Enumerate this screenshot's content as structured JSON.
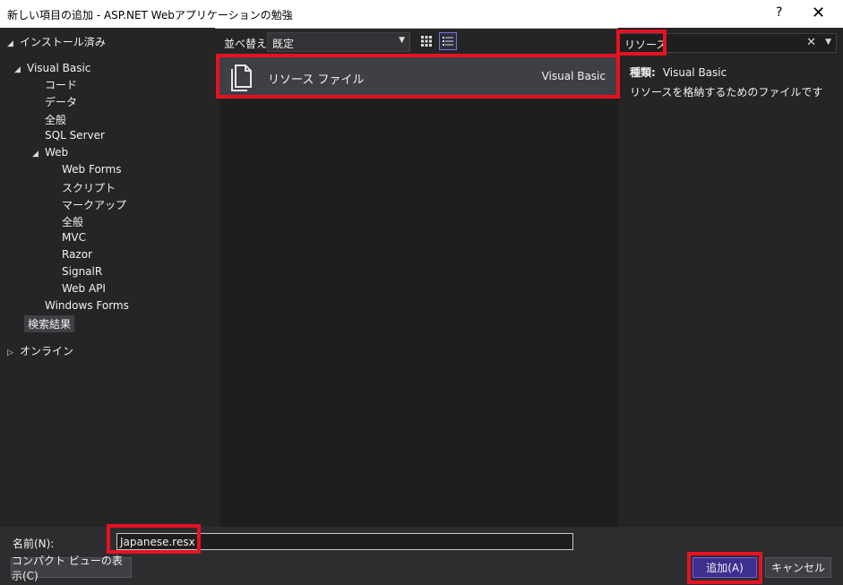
{
  "window": {
    "title": "新しい項目の追加 - ASP.NET Webアプリケーションの勉強",
    "help": "?",
    "close": "✕"
  },
  "tree": {
    "installed": "インストール済み",
    "visual_basic": "Visual Basic",
    "code": "コード",
    "data": "データ",
    "general": "全般",
    "sql_server": "SQL Server",
    "web": "Web",
    "web_forms": "Web Forms",
    "script": "スクリプト",
    "markup": "マークアップ",
    "web_general": "全般",
    "mvc": "MVC",
    "razor": "Razor",
    "signalr": "SignalR",
    "web_api": "Web API",
    "windows_forms": "Windows Forms",
    "search_results": "検索結果",
    "online": "オンライン"
  },
  "toolbar": {
    "sort_label": "並べ替え:",
    "sort_value": "既定"
  },
  "templates": [
    {
      "name": "リソース ファイル",
      "language": "Visual Basic"
    }
  ],
  "search": {
    "value": "リソース",
    "clear": "✕"
  },
  "details": {
    "type_label": "種類:",
    "type_value": "Visual Basic",
    "description": "リソースを格納するためのファイルです"
  },
  "bottom": {
    "name_label": "名前(N):",
    "name_value": "Japanese.resx",
    "compact_view": "コンパクト ビューの表示(C)",
    "add": "追加(A)",
    "cancel": "キャンセル"
  },
  "colors": {
    "background": "#252526",
    "list_background": "#1e1e1e",
    "selected_item": "#3f3f46",
    "primary_button": "#3e2f8f",
    "highlight_box": "#e81123"
  }
}
